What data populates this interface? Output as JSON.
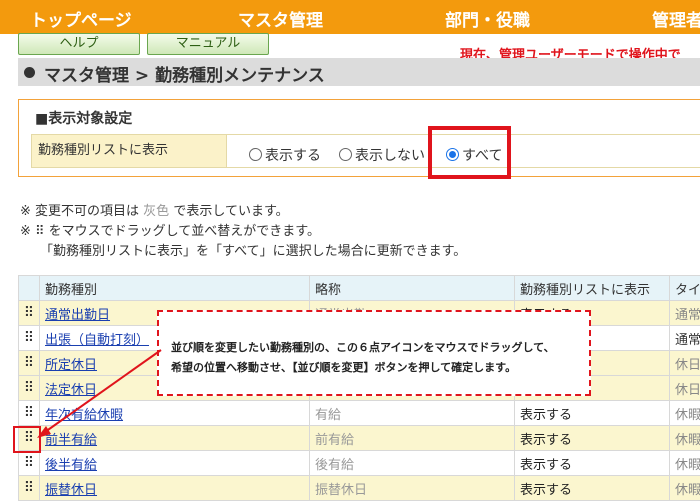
{
  "nav": {
    "top_page": "トップページ",
    "master": "マスタ管理",
    "dept": "部門・役職",
    "admin": "管理者"
  },
  "buttons": {
    "help": "ヘルプ",
    "manual": "マニュアル"
  },
  "mode_text": "現在、管理ユーザーモードで操作中で",
  "page_title": "マスタ管理 > 勤務種別メンテナンス",
  "settings": {
    "section_title": "■表示対象設定",
    "label": "勤務種別リストに表示",
    "options": [
      "表示する",
      "表示しない",
      "すべて"
    ],
    "selected": "すべて"
  },
  "notes": {
    "line1_a": "※ 変更不可の項目は",
    "line1_grey": "灰色",
    "line1_b": "で表示しています。",
    "line2": "※ ⠿ をマウスでドラッグして並べ替えができます。",
    "line3": "「勤務種別リストに表示」を「すべて」に選択した場合に更新できます。"
  },
  "table": {
    "headers": [
      "勤務種別",
      "略称",
      "勤務種別リストに表示",
      "タイプ"
    ],
    "rows": [
      {
        "name": "通常出勤日",
        "abbr": "通常出勤",
        "show": "表示する",
        "type": "通常",
        "yellow": true,
        "bold": false
      },
      {
        "name": "出張（自動打刻）",
        "abbr": "",
        "show": "",
        "type": "通常勤",
        "yellow": false,
        "bold": true
      },
      {
        "name": "所定休日",
        "abbr": "",
        "show": "",
        "type": "休日",
        "yellow": true,
        "bold": false
      },
      {
        "name": "法定休日",
        "abbr": "",
        "show": "",
        "type": "休日",
        "yellow": true,
        "bold": false
      },
      {
        "name": "年次有給休暇",
        "abbr": "有給",
        "show": "表示する",
        "type": "休暇",
        "yellow": false,
        "bold": false
      },
      {
        "name": "前半有給",
        "abbr": "前有給",
        "show": "表示する",
        "type": "休暇",
        "yellow": true,
        "bold": false
      },
      {
        "name": "後半有給",
        "abbr": "後有給",
        "show": "表示する",
        "type": "休暇",
        "yellow": false,
        "bold": false
      },
      {
        "name": "振替休日",
        "abbr": "振替休日",
        "show": "表示する",
        "type": "休暇",
        "yellow": true,
        "bold": false
      }
    ]
  },
  "callout": {
    "line1": "並び順を変更したい勤務種別の、この６点アイコンをマウスでドラッグして、",
    "line2": "希望の位置へ移動させ、【並び順を変更】ボタンを押して確定します。"
  },
  "colors": {
    "nav": "#f39a0d",
    "accent_red": "#e0141c",
    "link": "#1a3fb0",
    "yellow_row": "#fbf6cf"
  }
}
